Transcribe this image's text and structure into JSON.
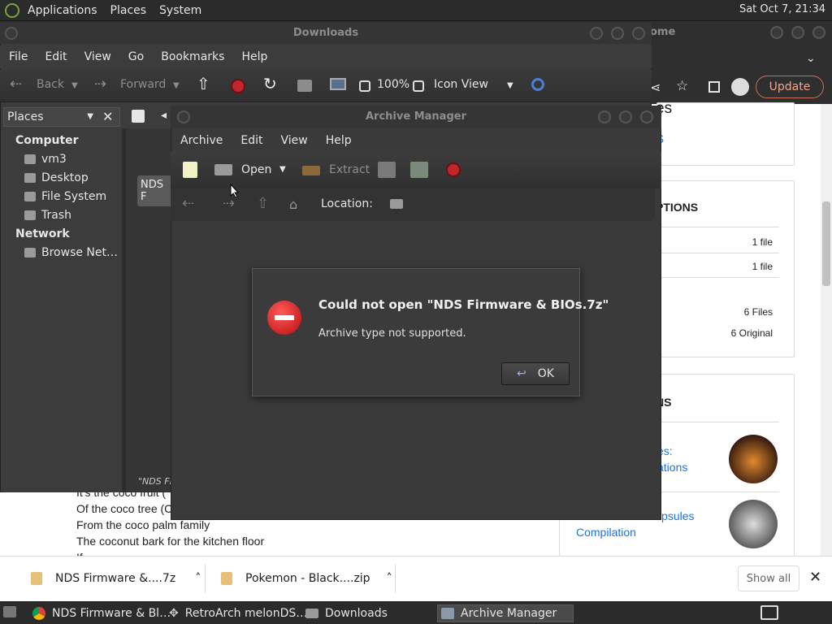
{
  "top_panel": {
    "menus": [
      "Applications",
      "Places",
      "System"
    ],
    "clock": "Sat Oct  7, 21:34"
  },
  "chrome": {
    "title_fragment": "ome",
    "update_label": "Update",
    "page": {
      "heading_fragment": "es",
      "link_fragment": "S",
      "section1_title": "PTIONS",
      "rows": [
        {
          "value": "1 file"
        },
        {
          "value": "1 file"
        },
        {
          "value": "6 Files"
        },
        {
          "value": "6 Original"
        }
      ],
      "section2_title": "NS",
      "related": [
        {
          "line1": "es:",
          "line2": "ations"
        },
        {
          "line1": "The Software Capsules",
          "line2": "Compilation"
        }
      ],
      "lyrics": [
        "It's the coco fruit (",
        "Of the coco tree (C",
        "From the coco palm family",
        "The coconut bark for the kitchen floor",
        "If"
      ]
    },
    "downloads": [
      {
        "name": "NDS Firmware &....7z"
      },
      {
        "name": "Pokemon - Black....zip"
      }
    ],
    "show_all": "Show all"
  },
  "nautilus": {
    "title": "Downloads",
    "menu": [
      "File",
      "Edit",
      "View",
      "Go",
      "Bookmarks",
      "Help"
    ],
    "toolbar": {
      "back": "Back",
      "forward": "Forward",
      "zoom": "100%",
      "view": "Icon View"
    },
    "places_label": "Places",
    "sidebar": {
      "computer_header": "Computer",
      "computer_items": [
        "vm3",
        "Desktop",
        "File System",
        "Trash"
      ],
      "network_header": "Network",
      "network_items": [
        "Browse Net…"
      ]
    },
    "file_label": "NDS F",
    "status": "\"NDS Fir"
  },
  "archive_manager": {
    "title": "Archive Manager",
    "menu": [
      "Archive",
      "Edit",
      "View",
      "Help"
    ],
    "toolbar": {
      "open": "Open",
      "extract": "Extract"
    },
    "location_label": "Location:"
  },
  "dialog": {
    "title": "Could not open \"NDS Firmware & BIOs.7z\"",
    "message": "Archive type not supported.",
    "ok": "OK"
  },
  "taskbar": {
    "tasks": [
      "NDS Firmware & Bl…",
      "RetroArch melonDS…",
      "Downloads",
      "Archive Manager"
    ]
  },
  "colors": {
    "panel": "#2b2b2b",
    "update_accent": "#c4735b",
    "link": "#1a73e8",
    "error_red": "#d21f1f"
  }
}
